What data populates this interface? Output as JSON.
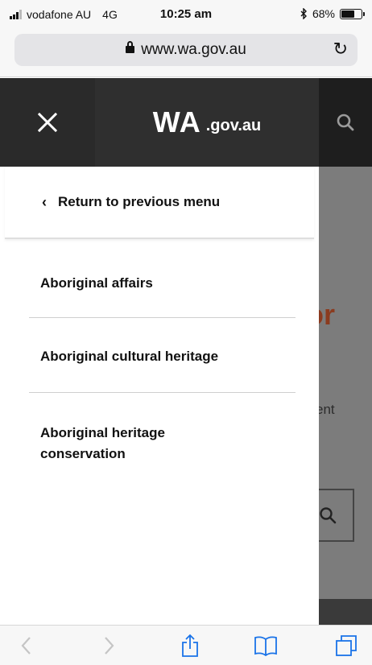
{
  "status_bar": {
    "carrier": "vodafone AU",
    "network": "4G",
    "time": "10:25 am",
    "bluetooth_icon": "bluetooth-icon",
    "battery_text": "68%",
    "battery_level": 0.68
  },
  "browser": {
    "url": "www.wa.gov.au",
    "lock_icon": "lock-icon",
    "reload_icon": "reload-icon"
  },
  "header": {
    "logo_main": "WA",
    "logo_suffix": ".gov.au",
    "close_icon": "close-icon",
    "search_icon": "search-icon",
    "background_color": "#252525"
  },
  "drawer": {
    "back_label": "Return to previous menu",
    "back_icon": "chevron-left-icon",
    "items": [
      {
        "label": "Aboriginal affairs"
      },
      {
        "label": "Aboriginal cultural heritage"
      },
      {
        "label": "Aboriginal heritage conservation"
      }
    ]
  },
  "background_page": {
    "heading_fragment": "or",
    "text_fragment": "ent",
    "heading_color": "#8b3b1f"
  },
  "toolbar": {
    "back_icon": "chevron-left-icon",
    "forward_icon": "chevron-right-icon",
    "share_icon": "share-icon",
    "bookmarks_icon": "bookmarks-icon",
    "tabs_icon": "tabs-icon"
  }
}
